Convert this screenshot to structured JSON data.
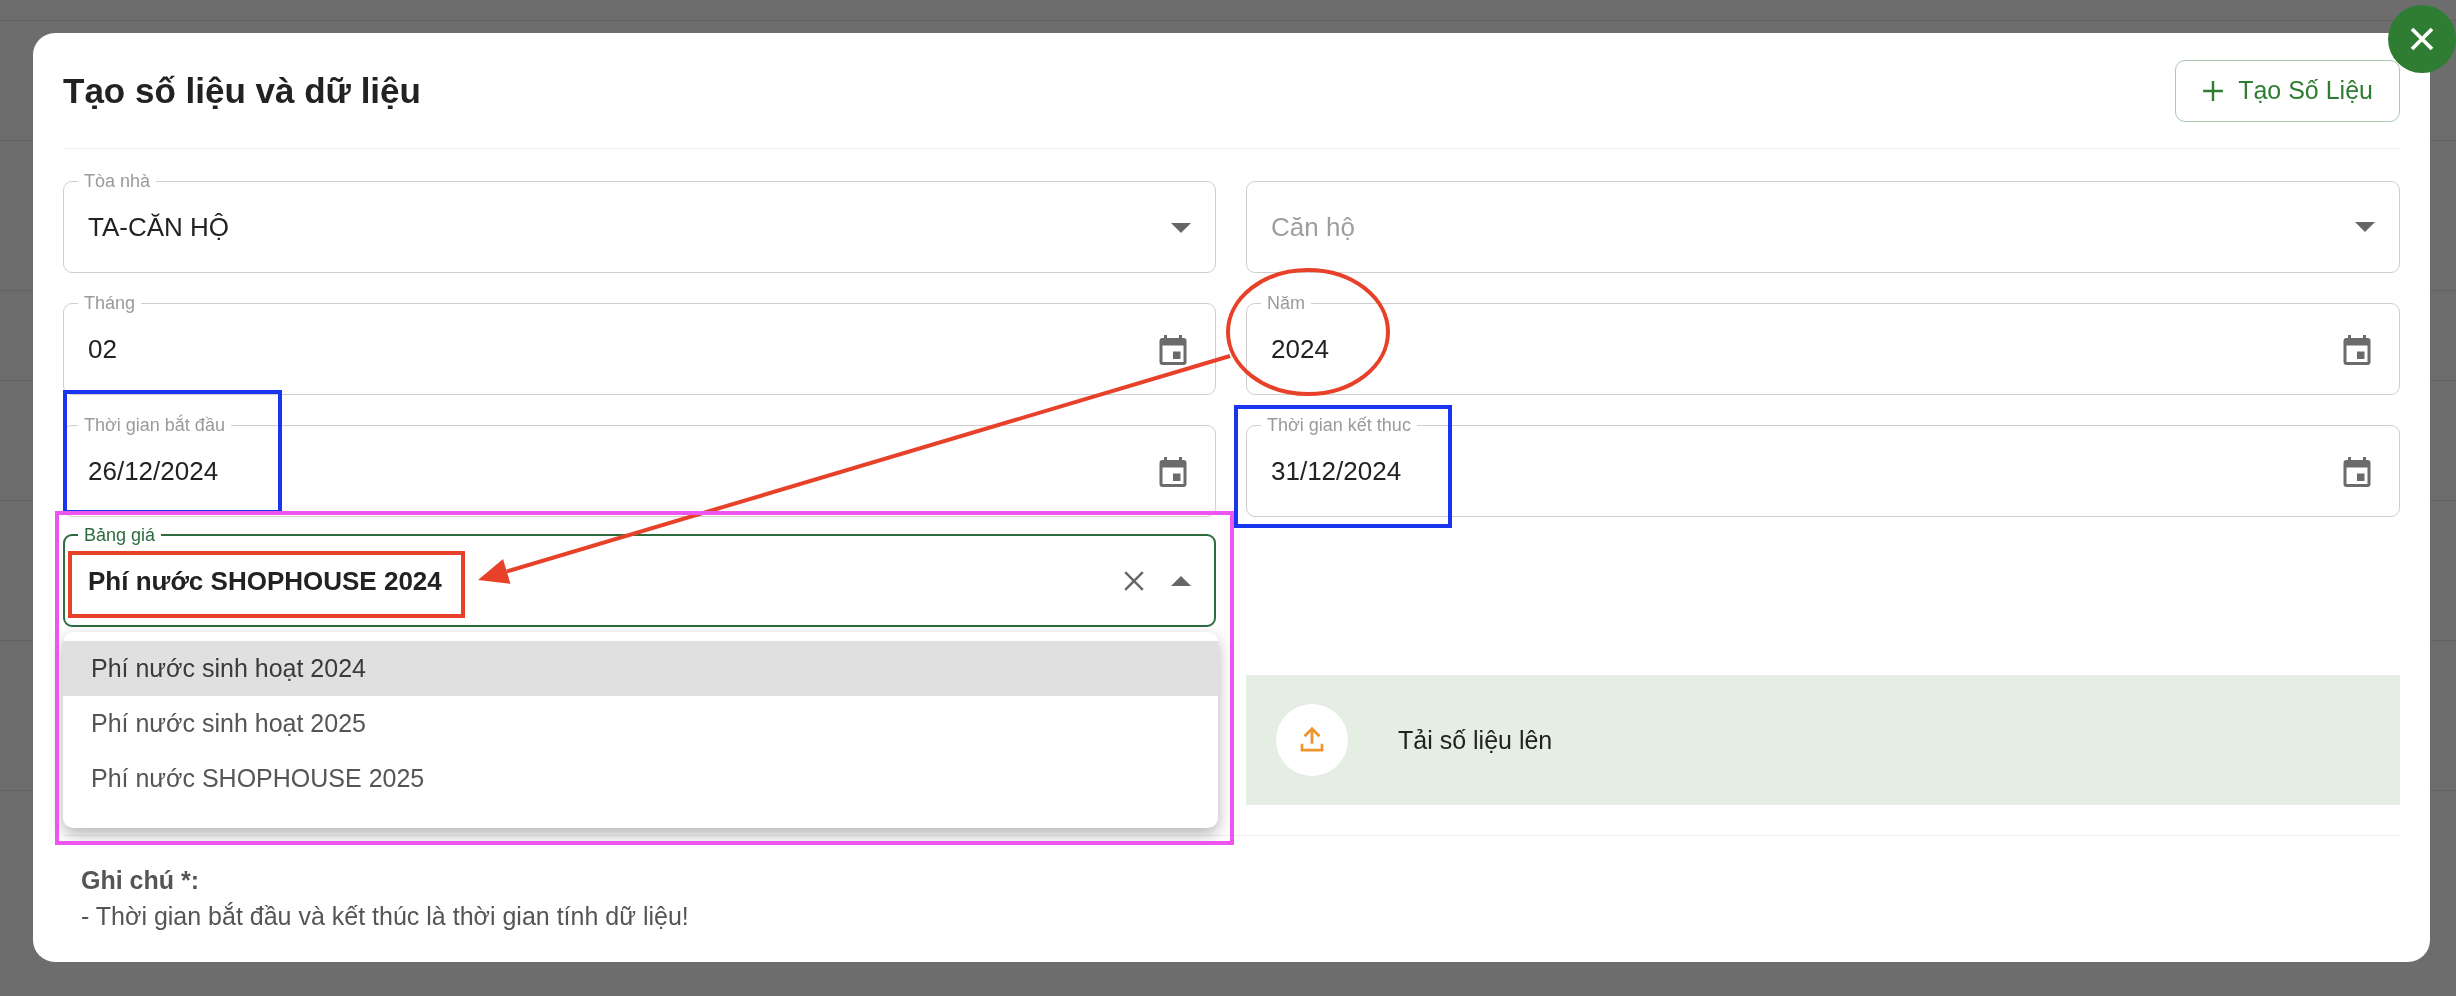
{
  "dialog": {
    "title": "Tạo số liệu và dữ liệu",
    "create_button": "Tạo Số Liệu"
  },
  "fields": [
    {
      "kind": "select",
      "label": "Tòa nhà",
      "value": "TA-CĂN HỘ"
    },
    {
      "kind": "select",
      "placeholder": "Căn hộ"
    },
    {
      "kind": "date",
      "label": "Tháng",
      "value": "02"
    },
    {
      "kind": "date",
      "label": "Năm",
      "value": "2024"
    },
    {
      "kind": "date",
      "label": "Thời gian bắt đầu",
      "value": "26/12/2024"
    },
    {
      "kind": "date",
      "label": "Thời gian kết thuc",
      "value": "31/12/2024"
    }
  ],
  "price_table": {
    "label": "Bảng giá",
    "value": "Phí nước SHOPHOUSE 2024",
    "focused": true,
    "options": [
      {
        "label": "Phí nước sinh hoạt 2024",
        "highlighted": true
      },
      {
        "label": "Phí nước sinh hoạt 2025",
        "highlighted": false
      },
      {
        "label": "Phí nước SHOPHOUSE 2025",
        "highlighted": false
      }
    ]
  },
  "upload": {
    "label": "Tải số liệu lên"
  },
  "note": {
    "title": "Ghi chú *:",
    "text": "- Thời gian bắt đầu và kết thúc là thời gian tính dữ liệu!"
  },
  "annotations": [
    {
      "kind": "ellipse",
      "color": "#e8412a"
    },
    {
      "kind": "arrow",
      "color": "#e8412a"
    },
    {
      "kind": "box",
      "color": "#e8412a"
    },
    {
      "kind": "box",
      "color": "#1a35f0"
    },
    {
      "kind": "box",
      "color": "#1a35f0"
    },
    {
      "kind": "box",
      "color": "#ec55f0"
    }
  ]
}
